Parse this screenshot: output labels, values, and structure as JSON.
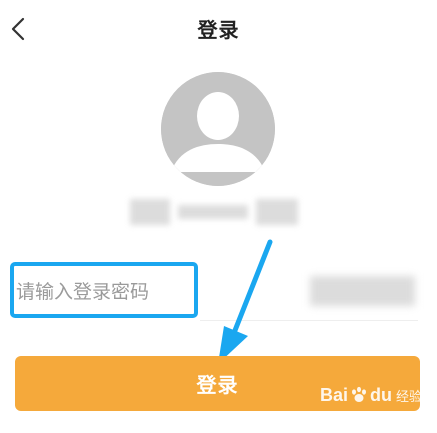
{
  "header": {
    "title": "登录",
    "back_icon": "chevron-left-icon"
  },
  "avatar": {
    "icon": "user-avatar-icon"
  },
  "password": {
    "placeholder": "请输入登录密码",
    "value": ""
  },
  "login_button": {
    "label": "登录"
  },
  "watermark": {
    "brand_bai": "Bai",
    "brand_du": "du",
    "text": "经验"
  },
  "colors": {
    "accent_blue": "#1aa7f0",
    "button_orange": "#f5a93b"
  }
}
